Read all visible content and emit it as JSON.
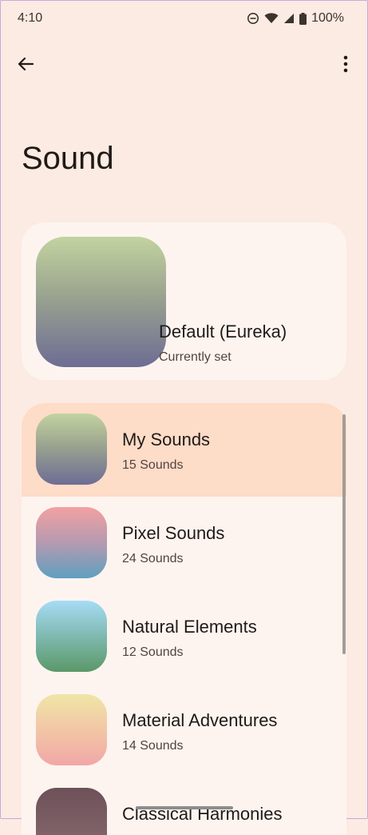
{
  "status_bar": {
    "time": "4:10",
    "battery": "100%",
    "icons": [
      "do-not-disturb-icon",
      "wifi-icon",
      "cell-signal-icon",
      "battery-icon"
    ]
  },
  "app_bar": {
    "back_icon": "arrow-back-icon",
    "more_icon": "more-vert-icon"
  },
  "page": {
    "title": "Sound"
  },
  "current_sound": {
    "name": "Default (Eureka)",
    "status": "Currently set",
    "gradient": [
      "#c3d3a0",
      "#6e6c94"
    ]
  },
  "categories": [
    {
      "name": "My Sounds",
      "count": "15 Sounds",
      "selected": true,
      "gradient": [
        "#c3d3a0",
        "#6e6c94"
      ]
    },
    {
      "name": "Pixel Sounds",
      "count": "24 Sounds",
      "selected": false,
      "gradient": [
        "#f3a1a1",
        "#5f9fbf"
      ]
    },
    {
      "name": "Natural Elements",
      "count": "12 Sounds",
      "selected": false,
      "gradient": [
        "#a6dcf6",
        "#5b9868"
      ]
    },
    {
      "name": "Material Adventures",
      "count": "14 Sounds",
      "selected": false,
      "gradient": [
        "#f0e6a6",
        "#f1a7a7"
      ]
    },
    {
      "name": "Classical Harmonies",
      "count": "",
      "selected": false,
      "gradient": [
        "#6e5158",
        "#8a6c72"
      ]
    }
  ],
  "colors": {
    "background": "#fcebe2",
    "card": "#fdf4f0",
    "selected": "#fddcc8"
  }
}
